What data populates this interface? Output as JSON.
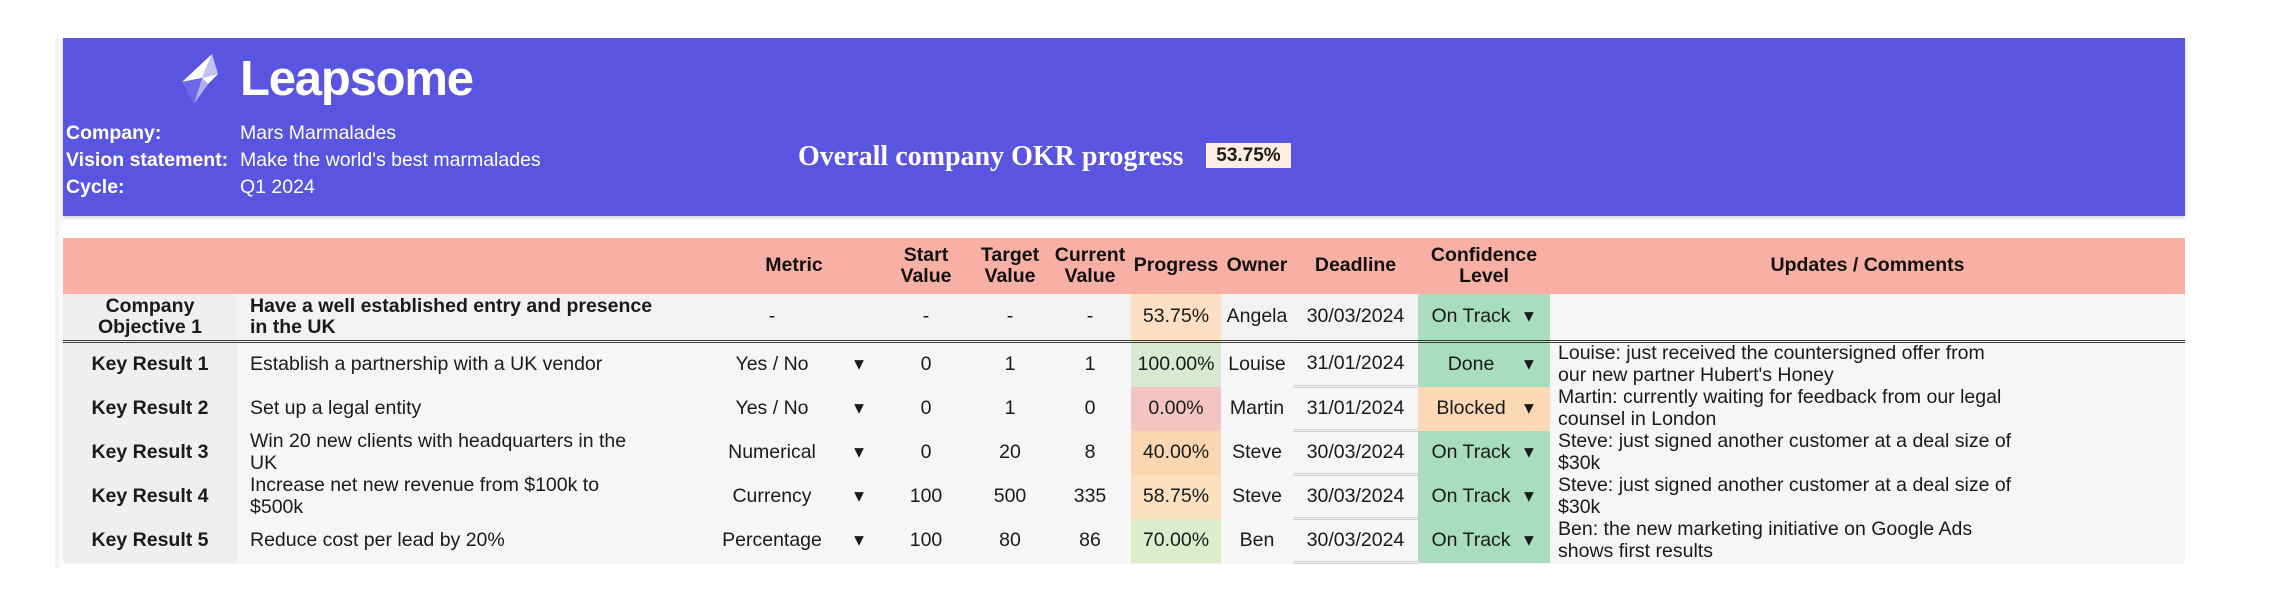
{
  "brand": {
    "name": "Leapsome",
    "banner_color": "#5a55e0",
    "logo_icon": "leapsome-origami-logo"
  },
  "header": {
    "fields": [
      {
        "label": "Company:",
        "value": "Mars Marmalades"
      },
      {
        "label": "Vision statement:",
        "value": "Make the world's best marmalades"
      },
      {
        "label": "Cycle:",
        "value": "Q1 2024"
      }
    ],
    "overall_title": "Overall company OKR progress",
    "overall_value": "53.75%",
    "overall_badge_color": "#fdeee1"
  },
  "table": {
    "columns": [
      "",
      "",
      "Metric",
      "",
      "Start Value",
      "Target Value",
      "Current Value",
      "Progress",
      "Owner",
      "Deadline",
      "Confidence Level",
      "",
      "Updates / Comments"
    ],
    "headers": {
      "metric": "Metric",
      "start_value": "Start\nValue",
      "start_value_l1": "Start",
      "start_value_l2": "Value",
      "target_value_l1": "Target",
      "target_value_l2": "Value",
      "current_value_l1": "Current",
      "current_value_l2": "Value",
      "progress": "Progress",
      "owner": "Owner",
      "deadline": "Deadline",
      "confidence_l1": "Confidence",
      "confidence_l2": "Level",
      "updates": "Updates / Comments"
    },
    "header_bg": "#f9b0a4",
    "objective": {
      "label_l1": "Company",
      "label_l2": "Objective 1",
      "description_l1": "Have a well established entry and presence",
      "description_l2": "in the UK",
      "metric": "-",
      "start_value": "-",
      "target_value": "-",
      "current_value": "-",
      "progress": "53.75%",
      "progress_color": "#fde0c4",
      "owner": "Angela",
      "deadline": "30/03/2024",
      "confidence": "On Track",
      "confidence_color": "#a8ddbf",
      "updates": ""
    },
    "key_results": [
      {
        "label": "Key Result 1",
        "description_l1": "Establish a partnership with a UK vendor",
        "description_l2": "",
        "metric": "Yes / No",
        "start_value": "0",
        "target_value": "1",
        "current_value": "1",
        "progress": "100.00%",
        "progress_color": "#d7ead0",
        "owner": "Louise",
        "deadline": "31/01/2024",
        "confidence": "Done",
        "confidence_color": "#a8ddbf",
        "updates_l1": "Louise: just received the countersigned offer from",
        "updates_l2": "our new partner Hubert's Honey"
      },
      {
        "label": "Key Result 2",
        "description_l1": "Set up a legal entity",
        "description_l2": "",
        "metric": "Yes / No",
        "start_value": "0",
        "target_value": "1",
        "current_value": "0",
        "progress": "0.00%",
        "progress_color": "#f4c4c0",
        "owner": "Martin",
        "deadline": "31/01/2024",
        "confidence": "Blocked",
        "confidence_color": "#fbd9b4",
        "updates_l1": "Martin: currently waiting for feedback from our legal",
        "updates_l2": "counsel in London"
      },
      {
        "label": "Key Result 3",
        "description_l1": "Win 20 new clients with headquarters in the",
        "description_l2": "UK",
        "metric": "Numerical",
        "start_value": "0",
        "target_value": "20",
        "current_value": "8",
        "progress": "40.00%",
        "progress_color": "#fad7b0",
        "owner": "Steve",
        "deadline": "30/03/2024",
        "confidence": "On Track",
        "confidence_color": "#a8ddbf",
        "updates_l1": "Steve: just signed another customer at a deal size of",
        "updates_l2": "$30k"
      },
      {
        "label": "Key Result 4",
        "description_l1": "Increase net new revenue from $100k to",
        "description_l2": "$500k",
        "metric": "Currency",
        "start_value": "100",
        "target_value": "500",
        "current_value": "335",
        "progress": "58.75%",
        "progress_color": "#fbe0c0",
        "owner": "Steve",
        "deadline": "30/03/2024",
        "confidence": "On Track",
        "confidence_color": "#a8ddbf",
        "updates_l1": "Steve: just signed another customer at a deal size of",
        "updates_l2": "$30k"
      },
      {
        "label": "Key Result 5",
        "description_l1": "Reduce cost per lead by 20%",
        "description_l2": "",
        "metric": "Percentage",
        "start_value": "100",
        "target_value": "80",
        "current_value": "86",
        "progress": "70.00%",
        "progress_color": "#dcedcd",
        "owner": "Ben",
        "deadline": "30/03/2024",
        "confidence": "On Track",
        "confidence_color": "#a8ddbf",
        "updates_l1": "Ben: the new marketing initiative on Google Ads",
        "updates_l2": "shows first results"
      }
    ],
    "dropdown_icon": "chevron-down-icon"
  }
}
